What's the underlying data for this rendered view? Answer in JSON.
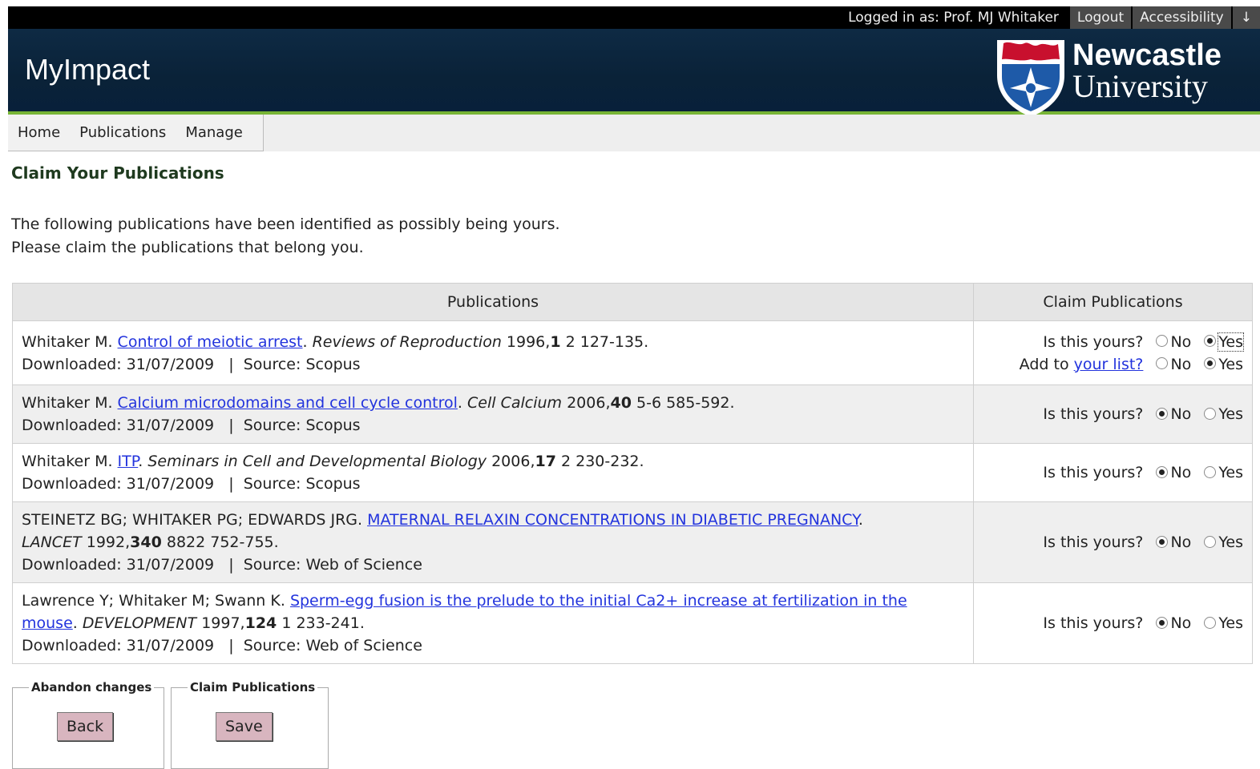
{
  "topbar": {
    "logged_in_label": "Logged in as: Prof. MJ Whitaker",
    "logout": "Logout",
    "accessibility": "Accessibility",
    "arrow": "↓"
  },
  "header": {
    "app_title": "MyImpact",
    "university_line1": "Newcastle",
    "university_line2": "University"
  },
  "nav": [
    "Home",
    "Publications",
    "Manage"
  ],
  "page": {
    "title": "Claim Your Publications",
    "intro_line1": "The following publications have been identified as possibly being yours.",
    "intro_line2": "Please claim the publications that belong you."
  },
  "table": {
    "col_publications": "Publications",
    "col_claim": "Claim Publications",
    "question": "Is this yours?",
    "add_to": "Add to",
    "your_list": "your list?",
    "no": "No",
    "yes": "Yes",
    "rows": [
      {
        "authors": "Whitaker M.",
        "title": "Control of meiotic arrest",
        "journal": "Reviews of Reproduction",
        "year": "1996,",
        "volume": "1",
        "pages": "2 127-135.",
        "meta": "Downloaded: 31/07/2009   |  Source: Scopus",
        "claimed": "yes",
        "add_to_list": "yes"
      },
      {
        "authors": "Whitaker M.",
        "title": "Calcium microdomains and cell cycle control",
        "journal": "Cell Calcium",
        "year": "2006,",
        "volume": "40",
        "pages": "5-6 585-592.",
        "meta": "Downloaded: 31/07/2009   |  Source: Scopus",
        "claimed": "no"
      },
      {
        "authors": "Whitaker M.",
        "title": "ITP",
        "journal": "Seminars in Cell and Developmental Biology",
        "year": "2006,",
        "volume": "17",
        "pages": "2 230-232.",
        "meta": "Downloaded: 31/07/2009   |  Source: Scopus",
        "claimed": "no"
      },
      {
        "authors": "STEINETZ BG; WHITAKER PG; EDWARDS JRG.",
        "title": "MATERNAL RELAXIN CONCENTRATIONS IN DIABETIC PREGNANCY",
        "journal": "LANCET",
        "year": "1992,",
        "volume": "340",
        "pages": "8822 752-755.",
        "meta": "Downloaded: 31/07/2009   |  Source: Web of Science",
        "claimed": "no"
      },
      {
        "authors": "Lawrence Y; Whitaker M; Swann K.",
        "title": "Sperm-egg fusion is the prelude to the initial Ca2+ increase at fertilization in the mouse",
        "journal": "DEVELOPMENT",
        "year": "1997,",
        "volume": "124",
        "pages": "1 233-241.",
        "meta": "Downloaded: 31/07/2009   |  Source: Web of Science",
        "claimed": "no"
      }
    ]
  },
  "actions": {
    "abandon_legend": "Abandon changes",
    "back": "Back",
    "claim_legend": "Claim Publications",
    "save": "Save"
  },
  "colors": {
    "header_bg": "#0a2238",
    "header_accent": "#77b435",
    "button_bg": "#d8b5bf",
    "link": "#2233dd"
  }
}
